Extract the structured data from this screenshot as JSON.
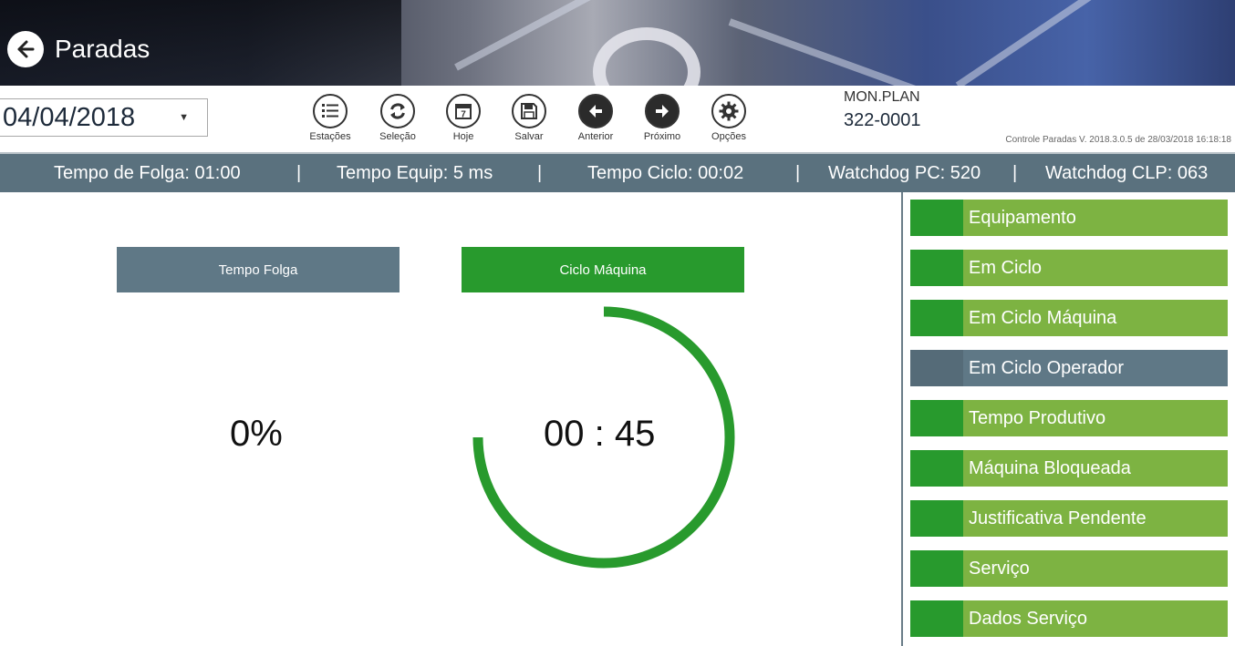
{
  "header": {
    "title": "Paradas"
  },
  "toolbar": {
    "date": "04/04/2018",
    "buttons": [
      {
        "label": "Estações",
        "icon": "list-icon"
      },
      {
        "label": "Seleção",
        "icon": "refresh-icon"
      },
      {
        "label": "Hoje",
        "icon": "calendar-icon",
        "day": "7"
      },
      {
        "label": "Salvar",
        "icon": "save-icon"
      },
      {
        "label": "Anterior",
        "icon": "arrow-left-icon"
      },
      {
        "label": "Próximo",
        "icon": "arrow-right-icon"
      },
      {
        "label": "Opções",
        "icon": "gear-icon"
      }
    ],
    "mon_label": "MON.PLAN",
    "mon_value": "322-0001",
    "version": "Controle Paradas V. 2018.3.0.5 de 28/03/2018 16:18:18"
  },
  "status": {
    "items": [
      "Tempo de Folga: 01:00",
      "Tempo Equip: 5 ms",
      "Tempo Ciclo: 00:02",
      "Watchdog PC: 520",
      "Watchdog CLP: 063"
    ],
    "separator": "|"
  },
  "main": {
    "folga_button": "Tempo Folga",
    "ciclo_button": "Ciclo Máquina",
    "percent": "0%",
    "timer": "00 : 45",
    "ring_progress": 0.75
  },
  "side_menu": {
    "items": [
      "Equipamento",
      "Em Ciclo",
      "Em Ciclo Máquina",
      "Em Ciclo Operador",
      "Tempo Produtivo",
      "Máquina Bloqueada",
      "Justificativa Pendente",
      "Serviço",
      "Dados Serviço"
    ],
    "selected_index": 3
  },
  "colors": {
    "green_dark": "#289a2d",
    "green_light": "#7db342",
    "slate": "#5f7886",
    "status_bar": "#5a717e"
  }
}
